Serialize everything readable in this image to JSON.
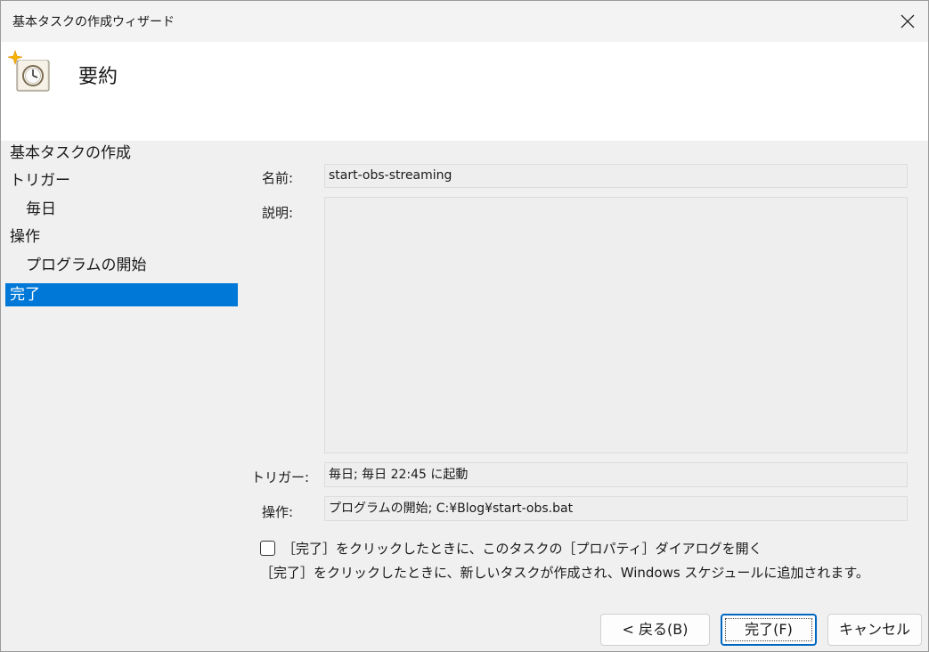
{
  "window": {
    "title": "基本タスクの作成ウィザード"
  },
  "header": {
    "title": "要約",
    "icon": "task-scheduler-clock-icon"
  },
  "nav": {
    "items": [
      {
        "label": "基本タスクの作成",
        "selected": false
      },
      {
        "label": "トリガー",
        "selected": false
      },
      {
        "label": "毎日",
        "selected": false
      },
      {
        "label": "操作",
        "selected": false
      },
      {
        "label": "プログラムの開始",
        "selected": false
      },
      {
        "label": "完了",
        "selected": true
      }
    ]
  },
  "summary": {
    "name_label": "名前:",
    "name_value": "start-obs-streaming",
    "description_label": "説明:",
    "description_value": "",
    "trigger_label": "トリガー:",
    "trigger_value": "毎日; 毎日 22:45 に起動",
    "action_label": "操作:",
    "action_value": "プログラムの開始; C:¥Blog¥start-obs.bat"
  },
  "options": {
    "open_properties_label": "［完了］をクリックしたときに、このタスクの［プロパティ］ダイアログを開く",
    "open_properties_checked": false,
    "info_text": "［完了］をクリックしたときに、新しいタスクが作成され、Windows スケジュールに追加されます。"
  },
  "buttons": {
    "back": "< 戻る(B)",
    "finish": "完了(F)",
    "cancel": "キャンセル"
  },
  "colors": {
    "selection": "#0078d7",
    "dialog_bg": "#f0f0f0",
    "field_bg": "#eeeeee"
  }
}
